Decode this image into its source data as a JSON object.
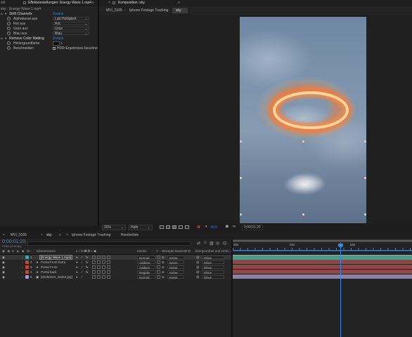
{
  "effects_panel": {
    "tab_left": "xkt",
    "tab_title": "Effekteinstellungen: Energy Wave 1.mp4",
    "breadcrumb": "sky · Energy Wave 1.mp4",
    "shift_channels": {
      "label": "Shift Channels",
      "reset": "Zurück"
    },
    "props": [
      {
        "label": "Alphakanal aus",
        "value": "Lab-Helligkeit"
      },
      {
        "label": "Rot aus",
        "value": "Rot"
      },
      {
        "label": "Grün aus",
        "value": "Grün"
      },
      {
        "label": "Blau aus",
        "value": "Blau"
      }
    ],
    "remove_color": {
      "label": "Remove Color Matting",
      "reset": "Zurück"
    },
    "bg_color_label": "Hintergrundfarbe",
    "crop_label": "Beschneiden",
    "hdr_label": "HDR-Ergebnisse beschnei"
  },
  "comp_panel": {
    "title": "Komposition: sky",
    "tabs": [
      "MVI_3165",
      "Iphone Footage Tracking",
      "sky"
    ],
    "zoom": "25%",
    "resolution": "Halb",
    "timecode": "0;00;01;20"
  },
  "timeline": {
    "tabs": [
      "MVI_3165",
      "sky",
      "Iphone Footage Tracking",
      "Renderliste"
    ],
    "timecode": "0:00:01:20",
    "frame_info": "00050 (30.00 fps)",
    "search_placeholder": "",
    "col_headers": {
      "nr": "Nr.",
      "name": "Ebenenname",
      "mode": "Modus",
      "t": "T",
      "trkmat": "Bewegte Maske",
      "parent": "Übergeordnet und verkn..."
    },
    "ruler": [
      "00s",
      "02s",
      "04s"
    ],
    "layers": [
      {
        "nr": "1",
        "name": "[Energy Wave 1.mp4]",
        "mode": "Normal",
        "trk": "Keine",
        "parent": "Ohne",
        "color": "#3fa7a0",
        "bar": "#3a8f7e"
      },
      {
        "nr": "2",
        "name": "Portal Front Extra",
        "mode": "Addiere",
        "trk": "Keine",
        "parent": "Ohne",
        "color": "#c8463e",
        "bar": "#8f4646"
      },
      {
        "nr": "3",
        "name": "Portal Front",
        "mode": "Addiere",
        "trk": "Keine",
        "parent": "Ohne",
        "color": "#c8463e",
        "bar": "#8f4646"
      },
      {
        "nr": "4",
        "name": "Portal back",
        "mode": "Negativ",
        "trk": "Keine",
        "parent": "Ohne",
        "color": "#c8463e",
        "bar": "#8f4646"
      },
      {
        "nr": "5",
        "name": "[20250424_45352.jpg]",
        "mode": "Normal",
        "trk": "Keine",
        "parent": "Ohne",
        "color": "#a99cc7",
        "bar": "#8c829f"
      }
    ]
  }
}
